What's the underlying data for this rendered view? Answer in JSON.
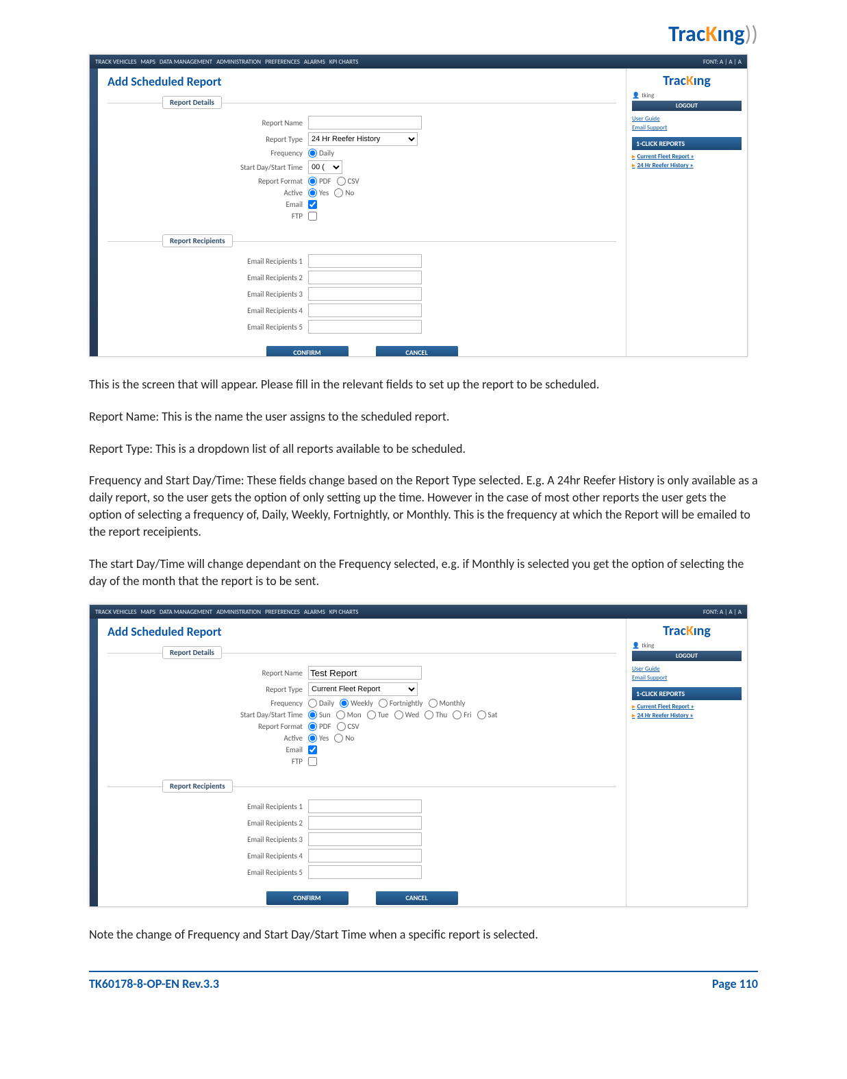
{
  "header_logo": {
    "t": "T",
    "rac": "rac",
    "k": "K",
    "ing": "ıng",
    "wave": "))"
  },
  "nav_items": [
    "TRACK VEHICLES",
    "MAPS",
    "DATA MANAGEMENT",
    "ADMINISTRATION",
    "PREFERENCES",
    "ALARMS",
    "KPI CHARTS"
  ],
  "font_label": "Font: a | A | A",
  "screen_title": "Add Scheduled Report",
  "fs_details": "Report Details",
  "fs_recipients": "Report Recipients",
  "labels": {
    "report_name": "Report Name",
    "report_type": "Report Type",
    "frequency": "Frequency",
    "start": "Start Day/Start Time",
    "format": "Report Format",
    "active": "Active",
    "email": "Email",
    "ftp": "FTP",
    "r1": "Email Recipients 1",
    "r2": "Email Recipients 2",
    "r3": "Email Recipients 3",
    "r4": "Email Recipients 4",
    "r5": "Email Recipients 5"
  },
  "shot1": {
    "report_name": "",
    "report_type": "24 Hr Reefer History",
    "freq": [
      "Daily"
    ],
    "freq_selected": "Daily",
    "start_value": "00 (",
    "fmt": [
      "PDF",
      "CSV"
    ],
    "fmt_selected": "PDF",
    "active": [
      "Yes",
      "No"
    ],
    "active_selected": "Yes",
    "email_checked": true,
    "ftp_checked": false
  },
  "shot2": {
    "report_name": "Test Report",
    "report_type": "Current Fleet Report",
    "freq": [
      "Daily",
      "Weekly",
      "Fortnightly",
      "Monthly"
    ],
    "freq_selected": "Weekly",
    "days": [
      "Sun",
      "Mon",
      "Tue",
      "Wed",
      "Thu",
      "Fri",
      "Sat"
    ],
    "day_selected": "Sun",
    "fmt": [
      "PDF",
      "CSV"
    ],
    "fmt_selected": "PDF",
    "active": [
      "Yes",
      "No"
    ],
    "active_selected": "Yes",
    "email_checked": true,
    "ftp_checked": false
  },
  "btn_confirm": "CONFIRM",
  "btn_cancel": "CANCEL",
  "side": {
    "user": "tking",
    "logout": "LOGOUT",
    "guide": "User Guide",
    "support": "Email Support",
    "panel": "1-CLICK REPORTS",
    "l1": "Current Fleet Report »",
    "l2": "24 Hr Reefer History »"
  },
  "body": {
    "p1": "This is the screen that will appear. Please fill in the relevant fields to set up the report to be scheduled.",
    "p2": "Report Name: This is the name the user assigns to the scheduled report.",
    "p3": "Report Type: This is a dropdown list of all reports available to be scheduled.",
    "p4": "Frequency and Start Day/Time: These fields change based on the Report Type selected. E.g. A 24hr Reefer History is only available as a daily report, so the user gets the option of only setting up the time. However in the case of most other reports the user gets the option of selecting a frequency of, Daily, Weekly, Fortnightly, or Monthly. This is the frequency at which the Report will be emailed to the report receipients.",
    "p5": "The start Day/Time will change dependant on the Frequency selected, e.g. if Monthly is selected you get the option of selecting the day of the month that the report is to be sent.",
    "p6": "Note the change of Frequency and Start Day/Start Time when a specific report is selected."
  },
  "footer": {
    "left": "TK60178-8-OP-EN Rev.3.3",
    "right": "Page  110"
  }
}
